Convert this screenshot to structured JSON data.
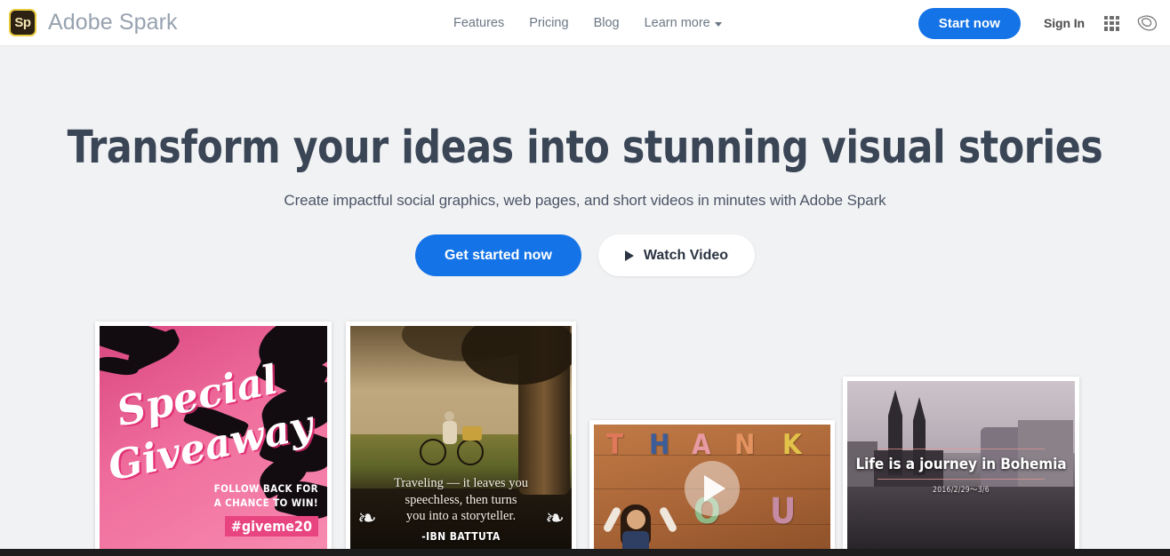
{
  "header": {
    "logo_text": "Sp",
    "logo_icon": "adobe-spark-logo-icon",
    "brand_name": "Adobe Spark",
    "nav": [
      {
        "label": "Features"
      },
      {
        "label": "Pricing"
      },
      {
        "label": "Blog"
      },
      {
        "label": "Learn more"
      }
    ],
    "start_now_label": "Start now",
    "sign_in_label": "Sign In",
    "app_grid_icon": "app-grid-icon",
    "creative_cloud_icon": "creative-cloud-icon",
    "accent_color": "#1473e6"
  },
  "hero": {
    "headline": "Transform your ideas into stunning visual stories",
    "subheadline": "Create impactful social graphics, web pages, and short videos in minutes with Adobe Spark",
    "primary_cta": "Get started now",
    "secondary_cta": "Watch Video",
    "secondary_cta_icon": "play-triangle-icon",
    "headline_color": "#3a4556"
  },
  "gallery": {
    "cards": [
      {
        "id": "special-giveaway",
        "type": "social-post",
        "title_line1": "Special",
        "title_line2": "Giveaway",
        "sub_line1": "FOLLOW BACK FOR",
        "sub_line2": "A CHANCE TO WIN!",
        "hashtag": "#giveme20",
        "bg_color": "#ef6d9c"
      },
      {
        "id": "travel-quote",
        "type": "social-post",
        "quote_line1": "Traveling — it leaves you",
        "quote_line2": "speechless, then turns",
        "quote_line3": "you into a storyteller.",
        "author": "-IBN BATTUTA",
        "ornament_icon": "laurel-wreath-icon"
      },
      {
        "id": "thank-you-video",
        "type": "video",
        "letters_top": [
          "T",
          "H",
          "A",
          "N",
          "K"
        ],
        "letters_bottom": [
          "O",
          "U"
        ],
        "play_icon": "play-button-overlay-icon"
      },
      {
        "id": "bohemia-page",
        "type": "web-page",
        "title": "Life is a journey in Bohemia",
        "date": "2016/2/29〜3/6"
      }
    ]
  }
}
